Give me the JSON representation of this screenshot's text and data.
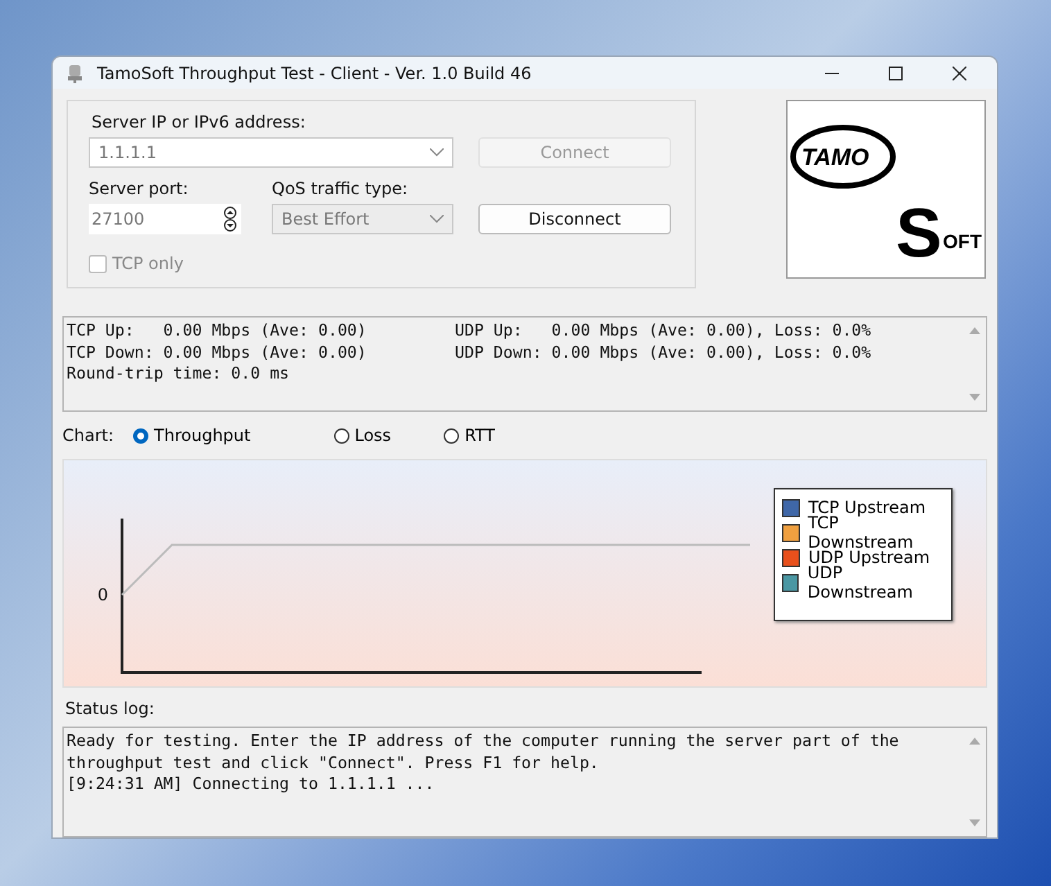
{
  "window": {
    "title": "TamoSoft Throughput Test - Client - Ver. 1.0 Build 46"
  },
  "connection": {
    "address_label": "Server IP or IPv6  address:",
    "address": {
      "value": "1.1.1.1",
      "disabled": true
    },
    "connect_button": {
      "label": "Connect",
      "disabled": true
    },
    "port_label": "Server port:",
    "port": {
      "value": "27100",
      "disabled": true
    },
    "qos_label": "QoS traffic type:",
    "qos": {
      "value": "Best Effort",
      "disabled": true
    },
    "disconnect_button": {
      "label": "Disconnect",
      "disabled": false
    },
    "tcp_only": {
      "label": "TCP only",
      "checked": false,
      "disabled": true
    }
  },
  "logo": {
    "left": "TAMO",
    "big": "S",
    "right": "OFT"
  },
  "stats": [
    [
      "TCP Up:   0.00 Mbps (Ave: 0.00)",
      "UDP Up:   0.00 Mbps (Ave: 0.00), Loss: 0.0%"
    ],
    [
      "TCP Down: 0.00 Mbps (Ave: 0.00)",
      "UDP Down: 0.00 Mbps (Ave: 0.00), Loss: 0.0%"
    ],
    [
      "Round-trip time: 0.0 ms"
    ]
  ],
  "chart": {
    "label": "Chart:",
    "modes": [
      {
        "label": "Throughput",
        "selected": true
      },
      {
        "label": "Loss",
        "selected": false
      },
      {
        "label": "RTT",
        "selected": false
      }
    ],
    "y_tick": "0",
    "legend": [
      {
        "label": "TCP Upstream",
        "color": "#3f67a8"
      },
      {
        "label": "TCP Downstream",
        "color": "#f0a040"
      },
      {
        "label": "UDP Upstream",
        "color": "#e8501c"
      },
      {
        "label": "UDP Downstream",
        "color": "#4a97a3"
      }
    ]
  },
  "status_log": {
    "label": "Status log:",
    "entries": [
      "Ready for testing. Enter the IP address of the computer running the server part of the throughput test and click \"Connect\". Press F1 for help.",
      "[9:24:31 AM] Connecting to 1.1.1.1 ..."
    ]
  }
}
